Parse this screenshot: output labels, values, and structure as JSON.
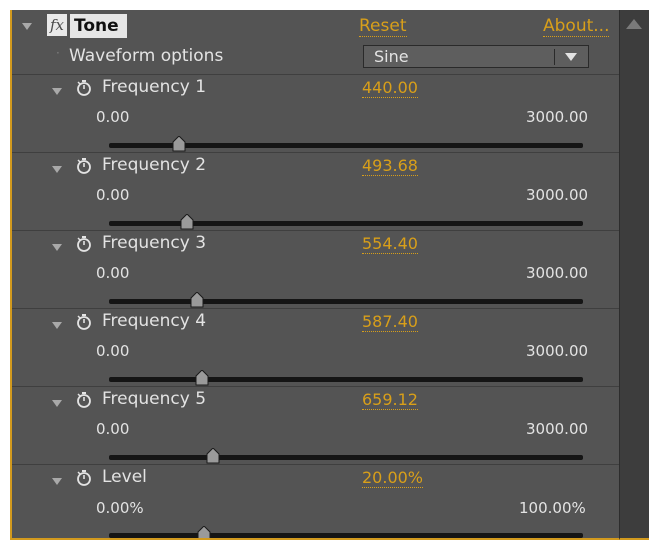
{
  "effect": {
    "fx_label": "fx",
    "title": "Tone",
    "reset_label": "Reset",
    "about_label": "About..."
  },
  "waveform": {
    "label": "Waveform options",
    "selected": "Sine"
  },
  "frequency_1": {
    "label": "Frequency 1",
    "value": "440.00",
    "min": "0.00",
    "max": "3000.00",
    "slider_fraction": 0.1467
  },
  "frequency_2": {
    "label": "Frequency 2",
    "value": "493.68",
    "min": "0.00",
    "max": "3000.00",
    "slider_fraction": 0.1646
  },
  "frequency_3": {
    "label": "Frequency 3",
    "value": "554.40",
    "min": "0.00",
    "max": "3000.00",
    "slider_fraction": 0.1848
  },
  "frequency_4": {
    "label": "Frequency 4",
    "value": "587.40",
    "min": "0.00",
    "max": "3000.00",
    "slider_fraction": 0.1958
  },
  "frequency_5": {
    "label": "Frequency 5",
    "value": "659.12",
    "min": "0.00",
    "max": "3000.00",
    "slider_fraction": 0.2197
  },
  "level": {
    "label": "Level",
    "value": "20.00%",
    "min": "0.00%",
    "max": "100.00%",
    "slider_fraction": 0.2
  },
  "colors": {
    "panel_bg": "#545454",
    "value_accent": "#d89f1a",
    "text": "#e3e3e3",
    "track": "#151515"
  },
  "icons": {
    "expand": "triangle-down-icon",
    "stopwatch": "stopwatch-icon",
    "scroll_up": "scroll-up-arrow-icon"
  }
}
